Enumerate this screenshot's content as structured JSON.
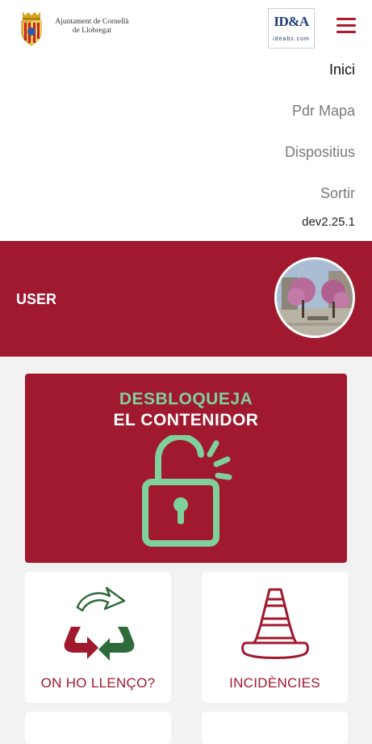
{
  "header": {
    "city_logo_text": [
      "Ajuntament de Cornellà",
      "de Llobregat"
    ],
    "partner_logo_main": "ID&A",
    "partner_logo_sub": "ideabs.com"
  },
  "menu": {
    "items": [
      {
        "label": "Inici",
        "active": true
      },
      {
        "label": "Pdr Mapa",
        "active": false
      },
      {
        "label": "Dispositius",
        "active": false
      },
      {
        "label": "Sortir",
        "active": false
      }
    ],
    "version": "dev2.25.1"
  },
  "user": {
    "name": "USER"
  },
  "unlock_card": {
    "line1": "DESBLOQUEJA",
    "line2": "EL CONTENIDOR"
  },
  "tiles": [
    {
      "label": "ON HO LLENÇO?",
      "icon": "recycle-icon"
    },
    {
      "label": "INCIDÈNCIES",
      "icon": "traffic-cone-icon"
    }
  ],
  "colors": {
    "brand_red": "#a0192e",
    "accent_green": "#7fd19b",
    "background": "#f2f2f2",
    "recycle_green": "#2f6b3a"
  }
}
